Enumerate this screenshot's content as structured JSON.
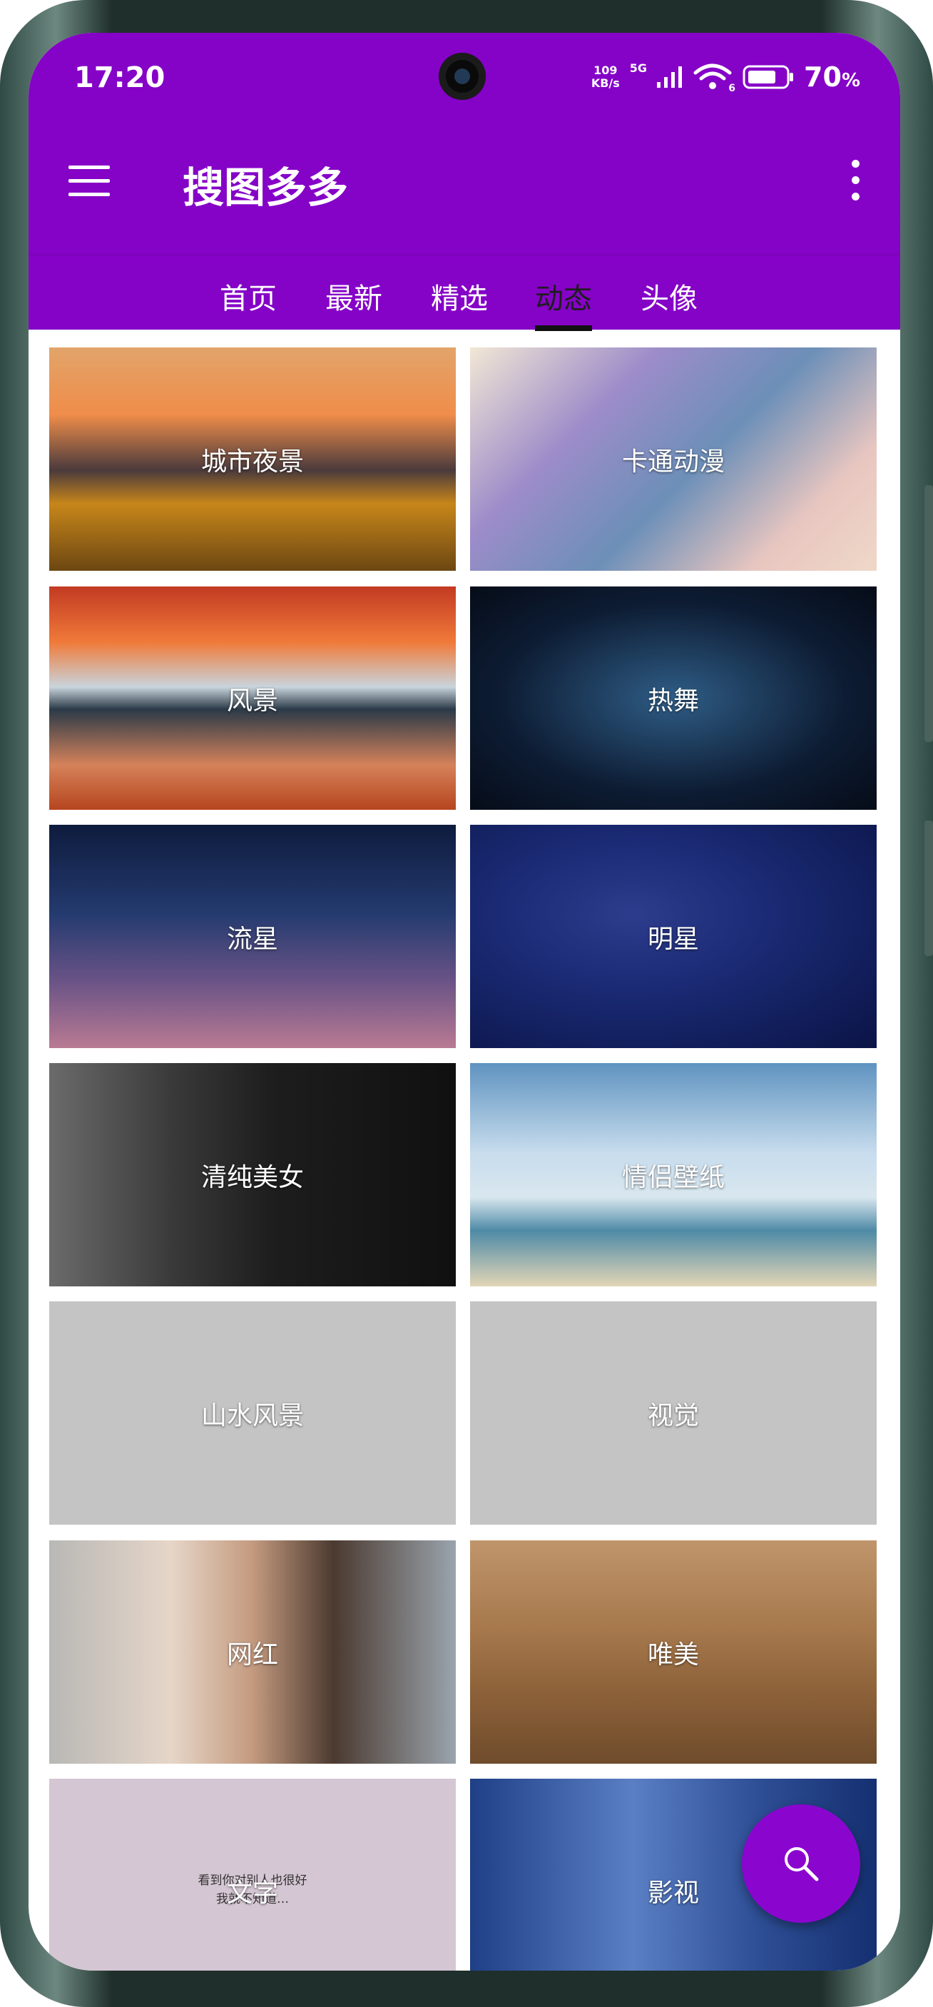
{
  "status_bar": {
    "time": "17:20",
    "net_speed_value": "109",
    "net_speed_unit": "KB/s",
    "network": "5G",
    "wifi_label": "6",
    "battery": "70",
    "battery_unit": "%"
  },
  "app_bar": {
    "title": "搜图多多",
    "menu_icon": "hamburger-menu-icon",
    "overflow_icon": "more-vert-icon"
  },
  "tabs": [
    {
      "label": "首页",
      "active": false
    },
    {
      "label": "最新",
      "active": false
    },
    {
      "label": "精选",
      "active": false
    },
    {
      "label": "动态",
      "active": true
    },
    {
      "label": "头像",
      "active": false
    }
  ],
  "tiles": [
    {
      "label": "城市夜景"
    },
    {
      "label": "卡通动漫"
    },
    {
      "label": "风景"
    },
    {
      "label": "热舞"
    },
    {
      "label": "流星"
    },
    {
      "label": "明星"
    },
    {
      "label": "清纯美女"
    },
    {
      "label": "情侣壁纸"
    },
    {
      "label": "山水风景"
    },
    {
      "label": "视觉"
    },
    {
      "label": "网红"
    },
    {
      "label": "唯美"
    },
    {
      "label": "文字",
      "overlay_text": [
        "看到你对别人也很好",
        "我就不知道…"
      ]
    },
    {
      "label": "影视"
    }
  ],
  "fab": {
    "icon": "search-icon"
  },
  "colors": {
    "primary": "#8502c7",
    "fab": "#8a06cf",
    "placeholder_tile": "#c4c4c4"
  }
}
